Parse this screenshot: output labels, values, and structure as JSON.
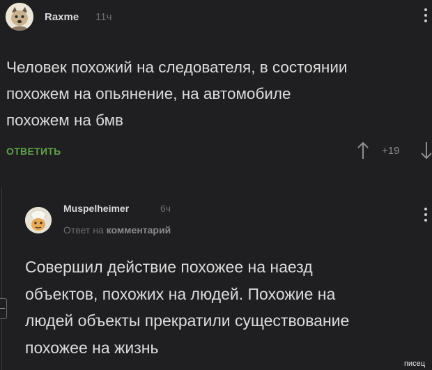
{
  "comment": {
    "author": "Raxme",
    "time": "11ч",
    "text": "Человек похожий на следователя, в состоянии\nпохожем на опьянение, на автомобиле\nпохожем на бмв",
    "reply_label": "ОТВЕТИТЬ",
    "rating": "+19"
  },
  "reply": {
    "author": "Muspelheimer",
    "time": "6ч",
    "reply_to_prefix": "Ответ на",
    "reply_to_target": "комментарий",
    "text": "Совершил действие похожее на наезд\nобъектов, похожих на людей. Похожие на\nлюдей объекты прекратили существование\nпохожее на жизнь"
  },
  "watermark": "писец",
  "colors": {
    "background": "#1f1f21",
    "reply_link": "#5fa34a",
    "muted": "#6d6d6d"
  }
}
